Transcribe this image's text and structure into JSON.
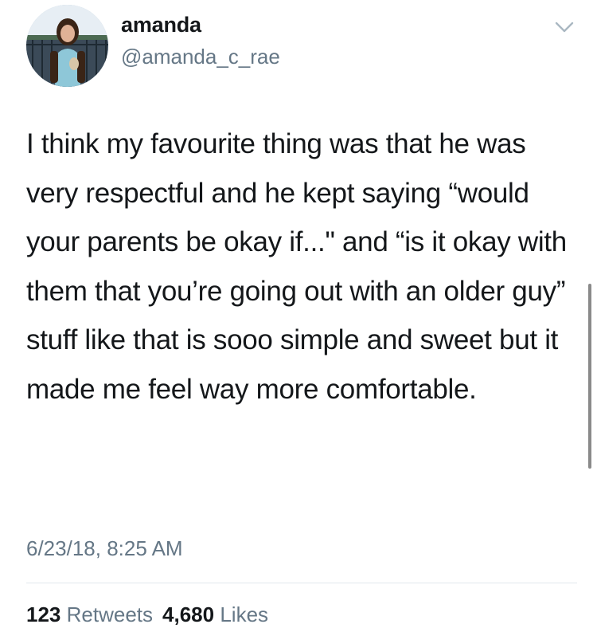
{
  "user": {
    "display_name": "amanda",
    "handle": "@amanda_c_rae",
    "avatar_icon": "profile-photo"
  },
  "tweet": {
    "text": "I think my favourite thing was that he was very respectful and he kept saying “would your parents be okay if...\" and “is it okay with them that you’re going out with an older guy” stuff like that is sooo simple and sweet but it made me feel way more comfortable.",
    "timestamp": "6/23/18, 8:25 AM"
  },
  "stats": {
    "retweets_count": "123",
    "retweets_label": "Retweets",
    "likes_count": "4,680",
    "likes_label": "Likes"
  },
  "icons": {
    "menu": "chevron-down-icon"
  },
  "colors": {
    "primary_text": "#14171a",
    "secondary_text": "#657786",
    "divider": "#e1e8ed"
  }
}
